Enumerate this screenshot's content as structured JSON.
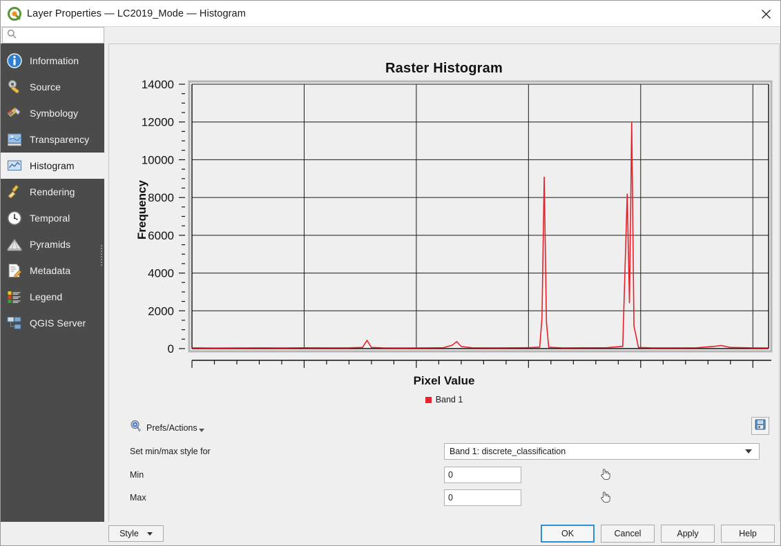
{
  "window": {
    "title": "Layer Properties — LC2019_Mode — Histogram",
    "logo_icon": "qgis-logo-icon",
    "close_icon": "close-icon"
  },
  "search": {
    "placeholder": "",
    "value": "",
    "icon": "search-icon"
  },
  "sidebar": {
    "items": [
      {
        "label": "Information",
        "icon": "information-icon",
        "selected": false
      },
      {
        "label": "Source",
        "icon": "source-icon",
        "selected": false
      },
      {
        "label": "Symbology",
        "icon": "symbology-icon",
        "selected": false
      },
      {
        "label": "Transparency",
        "icon": "transparency-icon",
        "selected": false
      },
      {
        "label": "Histogram",
        "icon": "histogram-icon",
        "selected": true
      },
      {
        "label": "Rendering",
        "icon": "rendering-icon",
        "selected": false
      },
      {
        "label": "Temporal",
        "icon": "temporal-clock-icon",
        "selected": false
      },
      {
        "label": "Pyramids",
        "icon": "pyramids-icon",
        "selected": false
      },
      {
        "label": "Metadata",
        "icon": "metadata-icon",
        "selected": false
      },
      {
        "label": "Legend",
        "icon": "legend-icon",
        "selected": false
      },
      {
        "label": "QGIS Server",
        "icon": "qgis-server-icon",
        "selected": false
      }
    ]
  },
  "chart_data": {
    "type": "line",
    "title": "Raster Histogram",
    "xlabel": "Pixel Value",
    "ylabel": "Frequency",
    "xlim": [
      0,
      257
    ],
    "ylim": [
      0,
      14000
    ],
    "xticks": [
      0,
      50,
      100,
      150,
      200,
      250
    ],
    "yticks": [
      0,
      2000,
      4000,
      6000,
      8000,
      10000,
      12000,
      14000
    ],
    "minor_y_step": 500,
    "minor_x_step": 10,
    "grid": true,
    "legend": [
      {
        "name": "Band 1",
        "color": "#e8202a"
      }
    ],
    "legend_position": "bottom-center",
    "series": [
      {
        "name": "Band 1",
        "color": "#e8202a",
        "points": [
          [
            0,
            40
          ],
          [
            10,
            30
          ],
          [
            20,
            35
          ],
          [
            30,
            40
          ],
          [
            40,
            35
          ],
          [
            50,
            45
          ],
          [
            60,
            40
          ],
          [
            70,
            40
          ],
          [
            76,
            60
          ],
          [
            78,
            430
          ],
          [
            80,
            60
          ],
          [
            85,
            40
          ],
          [
            95,
            35
          ],
          [
            105,
            40
          ],
          [
            112,
            45
          ],
          [
            116,
            180
          ],
          [
            118,
            370
          ],
          [
            120,
            110
          ],
          [
            125,
            45
          ],
          [
            135,
            40
          ],
          [
            145,
            45
          ],
          [
            150,
            50
          ],
          [
            155,
            80
          ],
          [
            156,
            1600
          ],
          [
            157,
            9100
          ],
          [
            158,
            1400
          ],
          [
            159,
            70
          ],
          [
            165,
            40
          ],
          [
            175,
            45
          ],
          [
            185,
            50
          ],
          [
            192,
            120
          ],
          [
            194,
            8200
          ],
          [
            195,
            2400
          ],
          [
            196,
            12000
          ],
          [
            197,
            1200
          ],
          [
            199,
            60
          ],
          [
            205,
            40
          ],
          [
            215,
            40
          ],
          [
            225,
            45
          ],
          [
            233,
            120
          ],
          [
            236,
            160
          ],
          [
            240,
            60
          ],
          [
            250,
            40
          ],
          [
            257,
            35
          ]
        ]
      }
    ]
  },
  "prefs": {
    "label": "Prefs/Actions",
    "icon": "prefs-actions-icon",
    "caret_icon": "caret-down-icon"
  },
  "save_chart": {
    "icon": "save-floppy-icon",
    "tooltip": ""
  },
  "form": {
    "minmax_style_label": "Set min/max style for",
    "band_select_value": "Band 1: discrete_classification",
    "band_select_caret_icon": "chevron-down-icon",
    "min_label": "Min",
    "min_value": "0",
    "max_label": "Max",
    "max_value": "0",
    "picker_icon": "hand-pointer-icon"
  },
  "footer": {
    "style_label": "Style",
    "style_caret_icon": "caret-down-icon",
    "ok_label": "OK",
    "cancel_label": "Cancel",
    "apply_label": "Apply",
    "help_label": "Help"
  },
  "colors": {
    "accent": "#2b8fd8",
    "series": "#e8202a",
    "sidebar_bg": "#4b4b4b",
    "panel_bg": "#efefef"
  }
}
